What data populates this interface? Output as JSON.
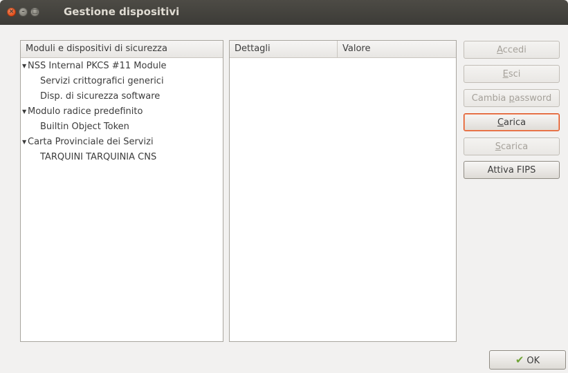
{
  "window": {
    "title": "Gestione dispositivi",
    "close_glyph": "×",
    "minimize_glyph": "–",
    "maximize_glyph": "□"
  },
  "modules_panel": {
    "header": "Moduli e dispositivi di sicurezza",
    "tree": [
      {
        "label": "NSS Internal PKCS #11 Module",
        "expander": "▼",
        "children": [
          "Servizi crittografici generici",
          "Disp. di sicurezza software"
        ]
      },
      {
        "label": "Modulo radice predefinito",
        "expander": "▼",
        "children": [
          "Builtin Object Token"
        ]
      },
      {
        "label": "Carta Provinciale dei Servizi",
        "expander": "▼",
        "children": [
          "TARQUINI TARQUINIA CNS"
        ]
      }
    ]
  },
  "details_panel": {
    "col_details": "Dettagli",
    "col_value": "Valore"
  },
  "buttons": {
    "accedi": {
      "pre": "",
      "mnemonic": "A",
      "post": "ccedi",
      "enabled": false
    },
    "esci": {
      "pre": "",
      "mnemonic": "E",
      "post": "sci",
      "enabled": false
    },
    "cambia_password": {
      "pre": "Cambia ",
      "mnemonic": "p",
      "post": "assword",
      "enabled": false
    },
    "carica": {
      "pre": "",
      "mnemonic": "C",
      "post": "arica",
      "enabled": true
    },
    "scarica": {
      "pre": "",
      "mnemonic": "S",
      "post": "carica",
      "enabled": false
    },
    "attiva_fips": {
      "label": "Attiva FIPS",
      "enabled": true
    }
  },
  "ok_button": {
    "check": "✔",
    "label": "OK"
  },
  "colors": {
    "titlebar": "#3c3b37",
    "close_button": "#dd4814",
    "focus_ring": "#dd4814",
    "disabled_text": "#a5a19a"
  }
}
